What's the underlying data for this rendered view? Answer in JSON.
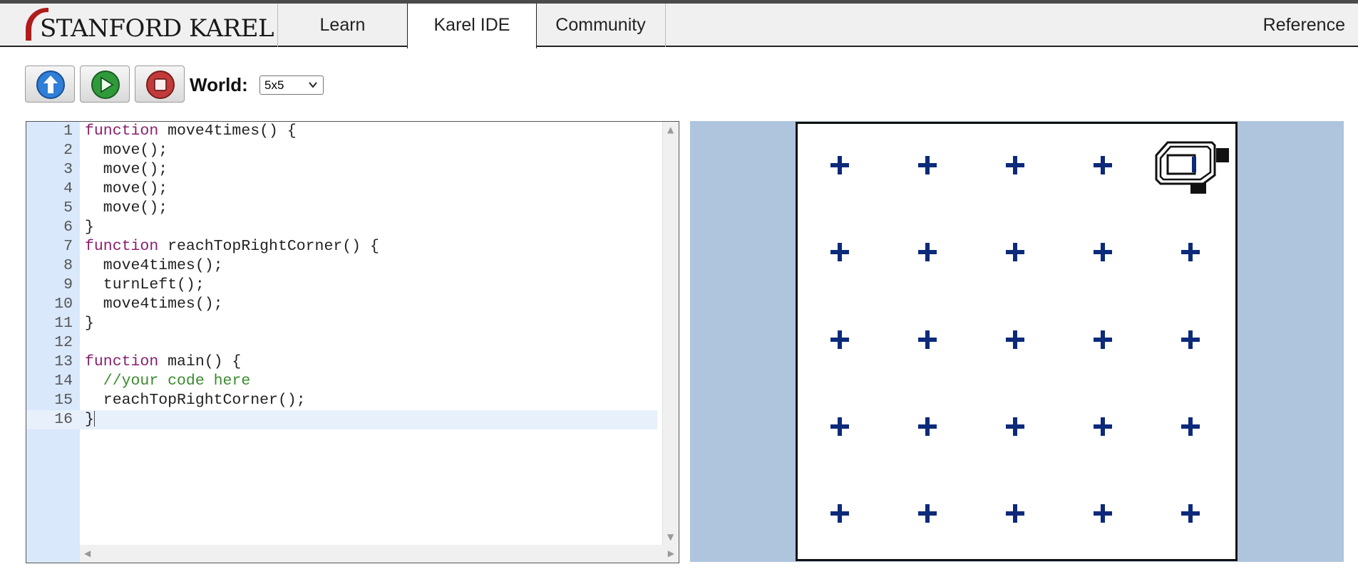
{
  "nav": {
    "logo": "STANFORD KAREL",
    "tabs": [
      {
        "label": "Learn",
        "active": false
      },
      {
        "label": "Karel IDE",
        "active": true
      },
      {
        "label": "Community",
        "active": false
      }
    ],
    "reference": "Reference"
  },
  "toolbar": {
    "buttons": [
      {
        "name": "reset",
        "icon": "up-arrow-icon",
        "color": "#2f7fd6"
      },
      {
        "name": "run",
        "icon": "play-icon",
        "color": "#2f9a3a"
      },
      {
        "name": "stop",
        "icon": "stop-icon",
        "color": "#c23a3a"
      }
    ],
    "world_label": "World:",
    "world_value": "5x5"
  },
  "editor": {
    "lines": [
      {
        "num": "1",
        "text": "function move4times() {"
      },
      {
        "num": "2",
        "text": "  move();"
      },
      {
        "num": "3",
        "text": "  move();"
      },
      {
        "num": "4",
        "text": "  move();"
      },
      {
        "num": "5",
        "text": "  move();"
      },
      {
        "num": "6",
        "text": "}"
      },
      {
        "num": "7",
        "text": "function reachTopRightCorner() {"
      },
      {
        "num": "8",
        "text": "  move4times();"
      },
      {
        "num": "9",
        "text": "  turnLeft();"
      },
      {
        "num": "10",
        "text": "  move4times();"
      },
      {
        "num": "11",
        "text": "}"
      },
      {
        "num": "12",
        "text": ""
      },
      {
        "num": "13",
        "text": "function main() {"
      },
      {
        "num": "14",
        "text": "  //your code here"
      },
      {
        "num": "15",
        "text": "  reachTopRightCorner();"
      },
      {
        "num": "16",
        "text": "}"
      }
    ],
    "active_line": "16"
  },
  "world": {
    "rows": 5,
    "cols": 5,
    "karel": {
      "row": 1,
      "col": 5,
      "facing": "north"
    },
    "colors": {
      "background": "#afc4dd",
      "beeper": "#0d2a7a"
    }
  }
}
